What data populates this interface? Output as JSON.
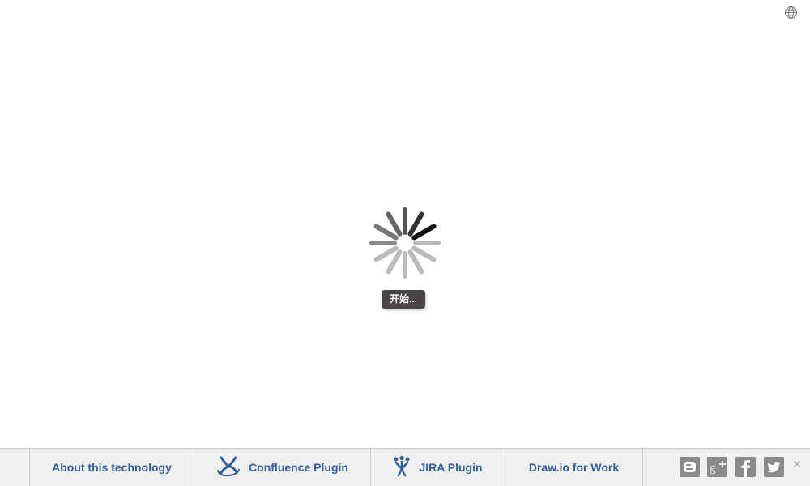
{
  "loading": {
    "status_text": "开始..."
  },
  "footer": {
    "links": [
      {
        "label": "About this technology"
      },
      {
        "label": "Confluence Plugin"
      },
      {
        "label": "JIRA Plugin"
      },
      {
        "label": "Draw.io for Work"
      }
    ],
    "close_label": "×"
  },
  "icons": {
    "language": "globe-icon",
    "confluence": "confluence-logo-icon",
    "jira": "jira-logo-icon",
    "social": [
      "blogger-icon",
      "google-plus-icon",
      "facebook-icon",
      "twitter-icon"
    ],
    "close": "close-icon"
  },
  "colors": {
    "link": "#2f5f9f",
    "footer_bg": "#f0f0f0",
    "status_bg": "#4a4446",
    "social_icon": "#8a8a8a"
  }
}
